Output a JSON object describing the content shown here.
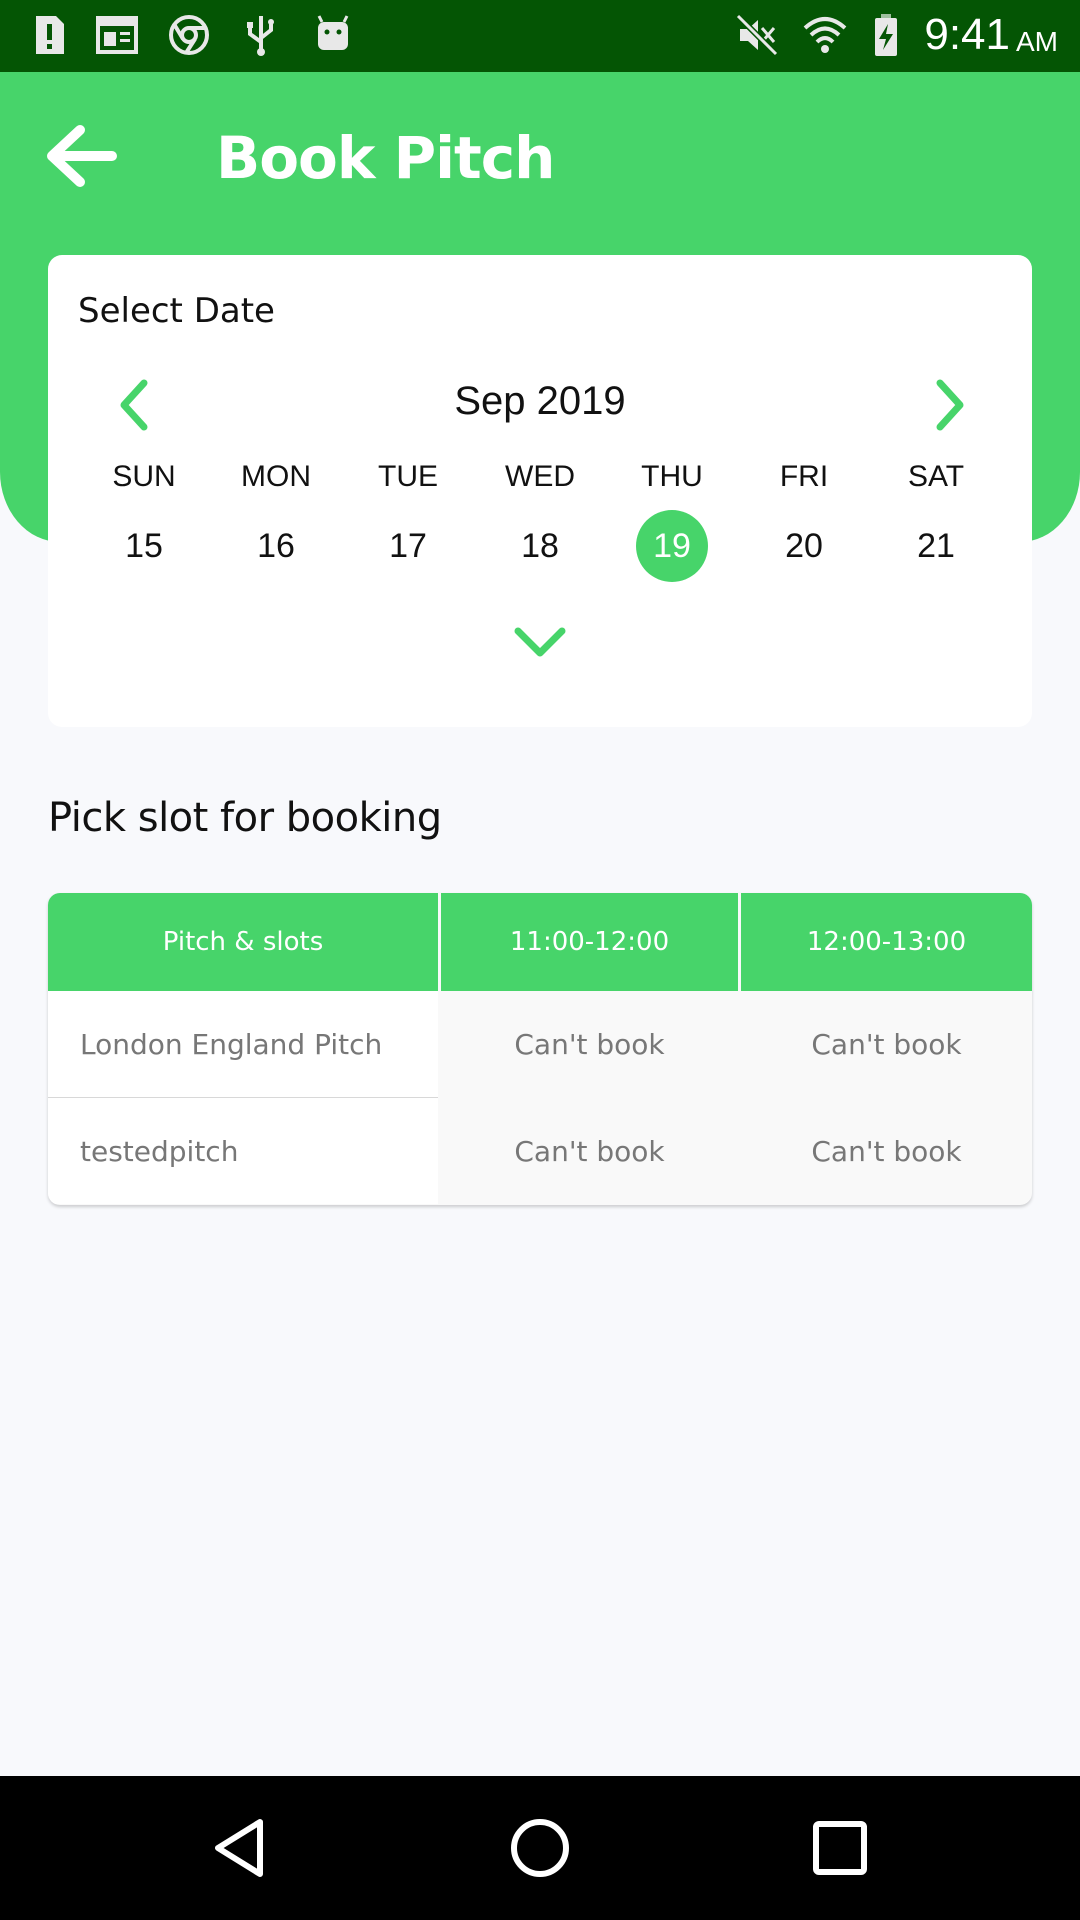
{
  "status_bar": {
    "time": "9:41",
    "ampm": "AM",
    "left_icons": [
      "alert-icon",
      "newspaper-icon",
      "chrome-icon",
      "usb-icon",
      "android-icon"
    ],
    "right_icons": [
      "mute-icon",
      "wifi-icon",
      "battery-charging-icon"
    ]
  },
  "header": {
    "title": "Book Pitch",
    "back_icon": "arrow-left-icon"
  },
  "calendar": {
    "label": "Select Date",
    "month": "Sep 2019",
    "weekdays": [
      "SUN",
      "MON",
      "TUE",
      "WED",
      "THU",
      "FRI",
      "SAT"
    ],
    "days": [
      "15",
      "16",
      "17",
      "18",
      "19",
      "20",
      "21"
    ],
    "selected_day": "19"
  },
  "slots": {
    "section_title": "Pick slot for booking",
    "headers": [
      "Pitch & slots",
      "11:00-12:00",
      "12:00-13:00"
    ],
    "rows": [
      {
        "pitch": "London England Pitch",
        "slots": [
          "Can't book",
          "Can't book"
        ]
      },
      {
        "pitch": "testedpitch",
        "slots": [
          "Can't book",
          "Can't book"
        ]
      }
    ]
  },
  "colors": {
    "accent": "#47d46a",
    "status_bar": "#045504",
    "background": "#f8f9fc"
  }
}
